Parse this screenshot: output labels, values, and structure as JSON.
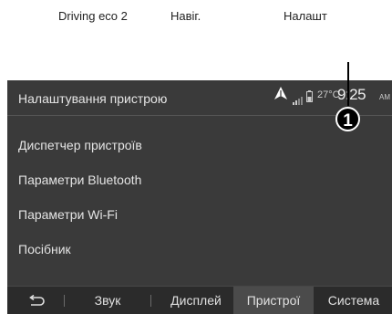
{
  "top_tabs": [
    "Driving eco 2",
    "Навіг.",
    "Налашт"
  ],
  "callout": "1",
  "screen": {
    "title": "Налаштування пристрою",
    "status": {
      "temperature": "27°C",
      "time": "9:25",
      "ampm": "AM"
    },
    "menu": [
      "Диспетчер пристроїв",
      "Параметри Bluetooth",
      "Параметри Wi-Fi",
      "Посібник"
    ],
    "bottom_tabs": [
      "Звук",
      "Дисплей",
      "Пристрої",
      "Система"
    ],
    "active_tab": "Пристрої"
  },
  "colors": {
    "screen_bg": "#3a3a3a",
    "bottom_bar_bg": "#2b2b2b",
    "active_tab_bg": "#4b4b4b",
    "text": "#e4e4e4"
  },
  "icons": [
    "back-arrow-icon",
    "navigation-arrow-icon",
    "signal-icon",
    "battery-icon"
  ]
}
